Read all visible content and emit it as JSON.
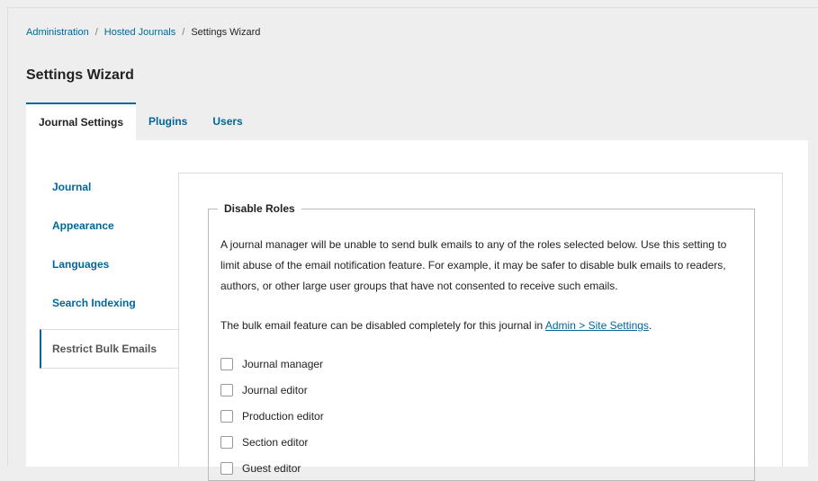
{
  "breadcrumb": {
    "items": [
      "Administration",
      "Hosted Journals"
    ],
    "separator": "/",
    "current": "Settings Wizard"
  },
  "page_title": "Settings Wizard",
  "tabs": [
    {
      "label": "Journal Settings",
      "active": true
    },
    {
      "label": "Plugins",
      "active": false
    },
    {
      "label": "Users",
      "active": false
    }
  ],
  "side_nav": [
    {
      "label": "Journal",
      "active": false
    },
    {
      "label": "Appearance",
      "active": false
    },
    {
      "label": "Languages",
      "active": false
    },
    {
      "label": "Search Indexing",
      "active": false
    },
    {
      "label": "Restrict Bulk Emails",
      "active": true
    }
  ],
  "disable_roles": {
    "legend": "Disable Roles",
    "description": "A journal manager will be unable to send bulk emails to any of the roles selected below. Use this setting to limit abuse of the email notification feature. For example, it may be safer to disable bulk emails to readers, authors, or other large user groups that have not consented to receive such emails.",
    "note_prefix": "The bulk email feature can be disabled completely for this journal in ",
    "note_link": "Admin > Site Settings",
    "note_suffix": ".",
    "roles": [
      {
        "label": "Journal manager",
        "checked": false
      },
      {
        "label": "Journal editor",
        "checked": false
      },
      {
        "label": "Production editor",
        "checked": false
      },
      {
        "label": "Section editor",
        "checked": false
      },
      {
        "label": "Guest editor",
        "checked": false
      }
    ]
  },
  "colors": {
    "link": "#006798",
    "page_background": "#eeeeee",
    "panel_background": "#ffffff",
    "border": "#dddddd"
  }
}
